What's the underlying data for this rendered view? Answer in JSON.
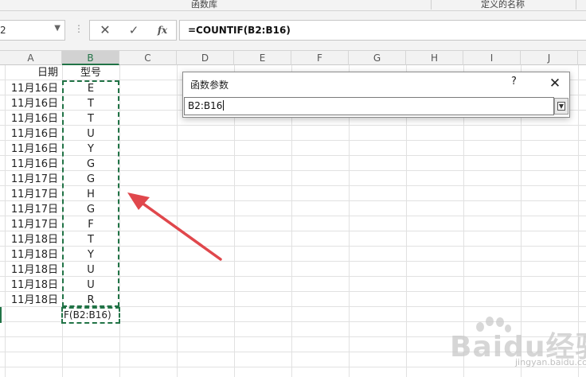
{
  "ribbon": {
    "groups": [
      {
        "label": "函数库"
      },
      {
        "label": "定义的名称"
      }
    ]
  },
  "formula_bar": {
    "name_box_value": "2",
    "dots_glyph": "⋮",
    "cancel_glyph": "✕",
    "enter_glyph": "✓",
    "fx_label": "fx",
    "formula": "=COUNTIF(B2:B16)"
  },
  "columns": [
    {
      "label": "A",
      "active": false
    },
    {
      "label": "B",
      "active": true
    },
    {
      "label": "C",
      "active": false
    },
    {
      "label": "D",
      "active": false
    },
    {
      "label": "E",
      "active": false
    },
    {
      "label": "F",
      "active": false
    },
    {
      "label": "G",
      "active": false
    },
    {
      "label": "H",
      "active": false
    },
    {
      "label": "I",
      "active": false
    },
    {
      "label": "J",
      "active": false
    }
  ],
  "sheet": {
    "header_row": {
      "a": "日期",
      "b": "型号"
    },
    "rows": [
      {
        "a": "11月16日",
        "b": "E"
      },
      {
        "a": "11月16日",
        "b": "T"
      },
      {
        "a": "11月16日",
        "b": "T"
      },
      {
        "a": "11月16日",
        "b": "U"
      },
      {
        "a": "11月16日",
        "b": "Y"
      },
      {
        "a": "11月16日",
        "b": "G"
      },
      {
        "a": "11月17日",
        "b": "G"
      },
      {
        "a": "11月17日",
        "b": "H"
      },
      {
        "a": "11月17日",
        "b": "G"
      },
      {
        "a": "11月17日",
        "b": "F"
      },
      {
        "a": "11月18日",
        "b": "T"
      },
      {
        "a": "11月18日",
        "b": "Y"
      },
      {
        "a": "11月18日",
        "b": "U"
      },
      {
        "a": "11月18日",
        "b": "U"
      },
      {
        "a": "11月18日",
        "b": "R"
      }
    ],
    "active_cell_text": "F(B2:B16)"
  },
  "dialog": {
    "title": "函数参数",
    "help_glyph": "?",
    "close_glyph": "✕",
    "input_value": "B2:B16",
    "expand_glyph": "▼"
  },
  "annotation": {
    "arrow_color": "#e0474c",
    "icon": "red-arrow-icon"
  },
  "watermark": {
    "text": "Baidu经验",
    "sub": "jingyan.baidu.com"
  },
  "colors": {
    "accent": "#217346",
    "grid": "#e1e1e1",
    "ribbon": "#f3f3f3"
  }
}
